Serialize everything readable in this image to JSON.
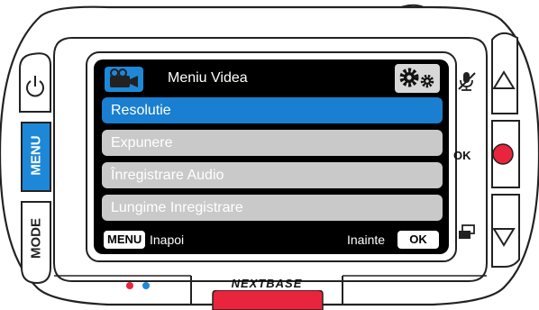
{
  "screen": {
    "title": "Meniu Videa",
    "items": [
      {
        "label": "Resolutie",
        "selected": true
      },
      {
        "label": "Expunere",
        "selected": false
      },
      {
        "label": "Înregistrare Audio",
        "selected": false
      },
      {
        "label": "Lungime Inregistrare",
        "selected": false
      }
    ],
    "footer": {
      "menu_key": "MENU",
      "back_label": "Inapoi",
      "next_label": "Inainte",
      "ok_key": "OK"
    }
  },
  "device": {
    "left_buttons": {
      "menu_label": "MENU",
      "mode_label": "MODE"
    },
    "ok_label": "OK",
    "brand_logo_text": "NEXTBASE"
  },
  "colors": {
    "selected_item": "#1a7fd0",
    "unselected_item": "#c9c9c9",
    "menu_button_blue": "#1e88d8",
    "record_button_red": "#e8253c",
    "screen_background": "#000000"
  },
  "icons": {
    "power": "power-icon",
    "video_camera": "video-camera-icon",
    "settings": "gears-icon",
    "mic_mute": "mic-mute-icon",
    "record": "record-icon",
    "up": "triangle-up-icon",
    "down": "triangle-down-icon",
    "dual_screen": "dual-screen-icon"
  }
}
